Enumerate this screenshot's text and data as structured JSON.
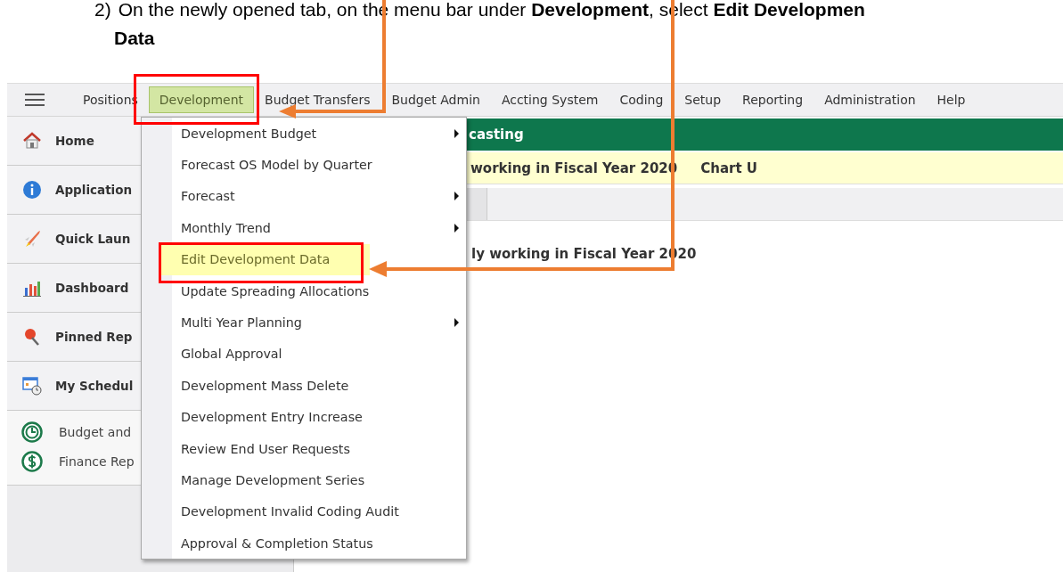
{
  "instruction": {
    "number": "2)",
    "text": "On the newly opened tab, on the menu bar under **Development**, select **Edit Developmen**",
    "continuation": "Data"
  },
  "menu_bar": {
    "items": [
      {
        "label": "Positions",
        "selected": false
      },
      {
        "label": "Development",
        "selected": true
      },
      {
        "label": "Budget Transfers",
        "selected": false
      },
      {
        "label": "Budget Admin",
        "selected": false
      },
      {
        "label": "Accting System",
        "selected": false
      },
      {
        "label": "Coding",
        "selected": false
      },
      {
        "label": "Setup",
        "selected": false
      },
      {
        "label": "Reporting",
        "selected": false
      },
      {
        "label": "Administration",
        "selected": false
      },
      {
        "label": "Help",
        "selected": false
      }
    ]
  },
  "sidebar": {
    "items": [
      {
        "label": "Home"
      },
      {
        "label": "Application"
      },
      {
        "label": "Quick Laun"
      },
      {
        "label": "Dashboard"
      },
      {
        "label": "Pinned Rep"
      },
      {
        "label": "My Schedul"
      }
    ],
    "links": [
      {
        "label": "Budget and"
      },
      {
        "label": "Finance Rep"
      }
    ]
  },
  "main": {
    "header": "casting",
    "notice": [
      "working in Fiscal Year 2020",
      "Chart U"
    ],
    "body_text": "ly working in Fiscal Year 2020"
  },
  "dropdown": {
    "items": [
      {
        "label": "Development Budget",
        "submenu": true,
        "selected": false
      },
      {
        "label": "Forecast OS Model by Quarter",
        "submenu": false,
        "selected": false
      },
      {
        "label": "Forecast",
        "submenu": true,
        "selected": false
      },
      {
        "label": "Monthly Trend",
        "submenu": true,
        "selected": false
      },
      {
        "label": "Edit Development Data",
        "submenu": false,
        "selected": true
      },
      {
        "label": "Update Spreading Allocations",
        "submenu": false,
        "selected": false
      },
      {
        "label": "Multi Year Planning",
        "submenu": true,
        "selected": false
      },
      {
        "label": "Global Approval",
        "submenu": false,
        "selected": false
      },
      {
        "label": "Development Mass Delete",
        "submenu": false,
        "selected": false
      },
      {
        "label": "Development Entry Increase",
        "submenu": false,
        "selected": false
      },
      {
        "label": "Review End User Requests",
        "submenu": false,
        "selected": false
      },
      {
        "label": "Manage Development Series",
        "submenu": false,
        "selected": false
      },
      {
        "label": "Development Invalid Coding Audit",
        "submenu": false,
        "selected": false
      },
      {
        "label": "Approval & Completion Status",
        "submenu": false,
        "selected": false
      }
    ]
  }
}
